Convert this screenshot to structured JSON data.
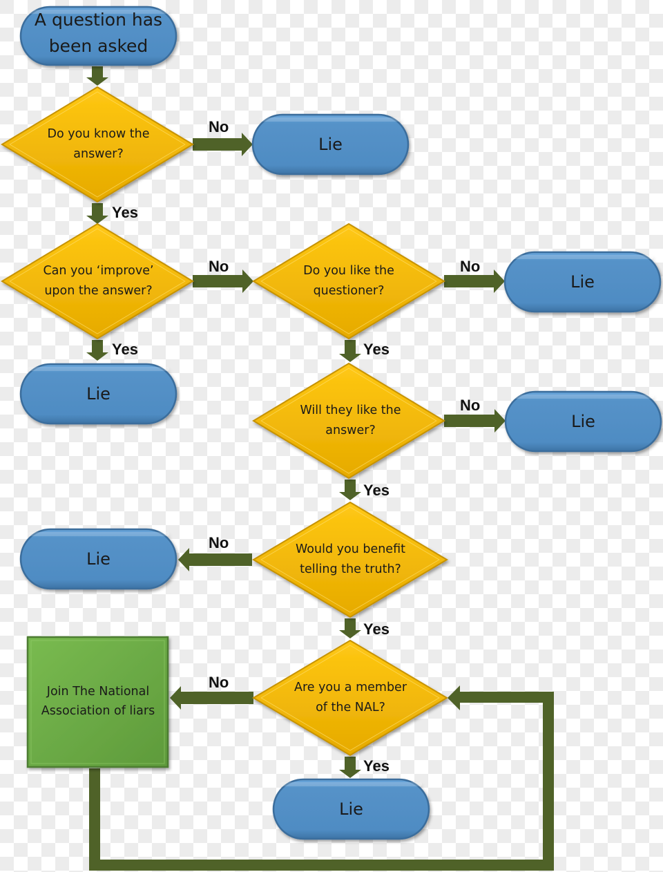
{
  "colors": {
    "terminal_fill": "#5390c6",
    "terminal_stroke": "#3a6d9c",
    "decision_fill": "#f5b700",
    "decision_stroke": "#c69200",
    "process_fill": "#6aab45",
    "process_stroke": "#4d7d30",
    "arrow": "#4f6228",
    "background_check": "#ececec"
  },
  "nodes": {
    "start": {
      "type": "terminal",
      "line1": "A question has",
      "line2": "been asked"
    },
    "q1": {
      "type": "decision",
      "line1": "Do you know the",
      "line2": "answer?"
    },
    "q2": {
      "type": "decision",
      "line1": "Can you ‘improve’",
      "line2": "upon the answer?"
    },
    "q3": {
      "type": "decision",
      "line1": "Do you like the",
      "line2": "questioner?"
    },
    "q4": {
      "type": "decision",
      "line1": "Will they like the",
      "line2": "answer?"
    },
    "q5": {
      "type": "decision",
      "line1": "Would you benefit",
      "line2": "telling the truth?"
    },
    "q6": {
      "type": "decision",
      "line1": "Are you a member",
      "line2": "of the NAL?"
    },
    "join": {
      "type": "process",
      "line1": "Join The National",
      "line2": "Association of liars"
    },
    "lie1": {
      "type": "terminal",
      "label": "Lie"
    },
    "lie2": {
      "type": "terminal",
      "label": "Lie"
    },
    "lie3": {
      "type": "terminal",
      "label": "Lie"
    },
    "lie4": {
      "type": "terminal",
      "label": "Lie"
    },
    "lie5": {
      "type": "terminal",
      "label": "Lie"
    },
    "lie6": {
      "type": "terminal",
      "label": "Lie"
    }
  },
  "edges": [
    {
      "from": "start",
      "to": "q1",
      "label": ""
    },
    {
      "from": "q1",
      "to": "lie1",
      "label": "No"
    },
    {
      "from": "q1",
      "to": "q2",
      "label": "Yes"
    },
    {
      "from": "q2",
      "to": "q3",
      "label": "No"
    },
    {
      "from": "q2",
      "to": "lie2",
      "label": "Yes"
    },
    {
      "from": "q3",
      "to": "lie3",
      "label": "No"
    },
    {
      "from": "q3",
      "to": "q4",
      "label": "Yes"
    },
    {
      "from": "q4",
      "to": "lie4",
      "label": "No"
    },
    {
      "from": "q4",
      "to": "q5",
      "label": "Yes"
    },
    {
      "from": "q5",
      "to": "lie5",
      "label": "No"
    },
    {
      "from": "q5",
      "to": "q6",
      "label": "Yes"
    },
    {
      "from": "q6",
      "to": "join",
      "label": "No"
    },
    {
      "from": "q6",
      "to": "lie6",
      "label": "Yes"
    },
    {
      "from": "join",
      "to": "q6",
      "label": ""
    }
  ]
}
